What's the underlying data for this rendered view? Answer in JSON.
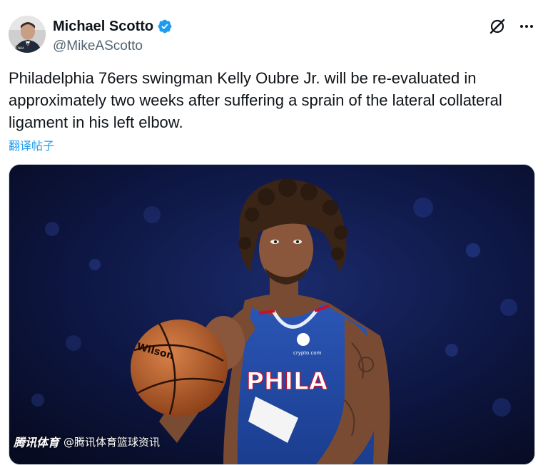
{
  "author": {
    "display_name": "Michael Scotto",
    "handle": "@MikeAScotto",
    "verified": true
  },
  "actions": {
    "grok_icon": "grok-icon",
    "more_icon": "more-options-icon"
  },
  "tweet": {
    "text": "Philadelphia 76ers swingman Kelly Oubre Jr. will be re-evaluated in\napproximately two weeks after suffering a sprain of the lateral collateral\nligament in his left elbow.",
    "translate_label": "翻译帖子"
  },
  "media": {
    "jersey_text": "PHILA",
    "watermark_logo": "腾讯体育",
    "watermark_text": "@腾讯体育篮球资讯"
  },
  "colors": {
    "link": "#1d9bf0",
    "handle": "#536471",
    "verified": "#1d9bf0",
    "jersey_blue": "#1d428a"
  }
}
